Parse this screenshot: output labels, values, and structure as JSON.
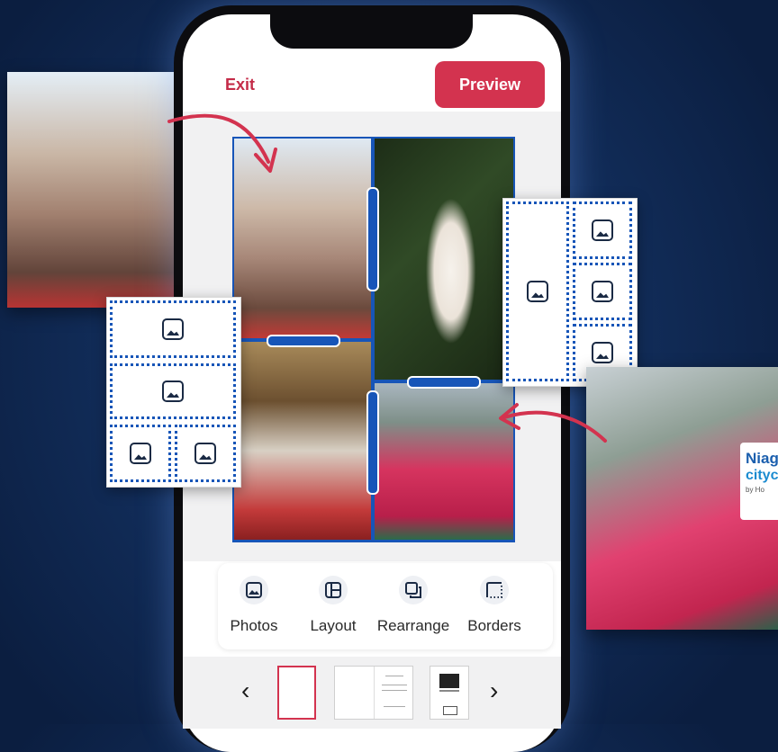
{
  "header": {
    "exit_label": "Exit",
    "preview_label": "Preview"
  },
  "toolbar": {
    "items": [
      {
        "label": "Photos",
        "icon": "image-icon"
      },
      {
        "label": "Layout",
        "icon": "layout-icon"
      },
      {
        "label": "Rearrange",
        "icon": "rearrange-icon"
      },
      {
        "label": "Borders",
        "icon": "borders-icon"
      }
    ]
  },
  "photo_sign": {
    "line1": "Niaga",
    "line2": "citycruis",
    "line3": "by Ho"
  },
  "colors": {
    "accent": "#d3334f",
    "selection": "#1755b8",
    "background": "#13305f"
  }
}
